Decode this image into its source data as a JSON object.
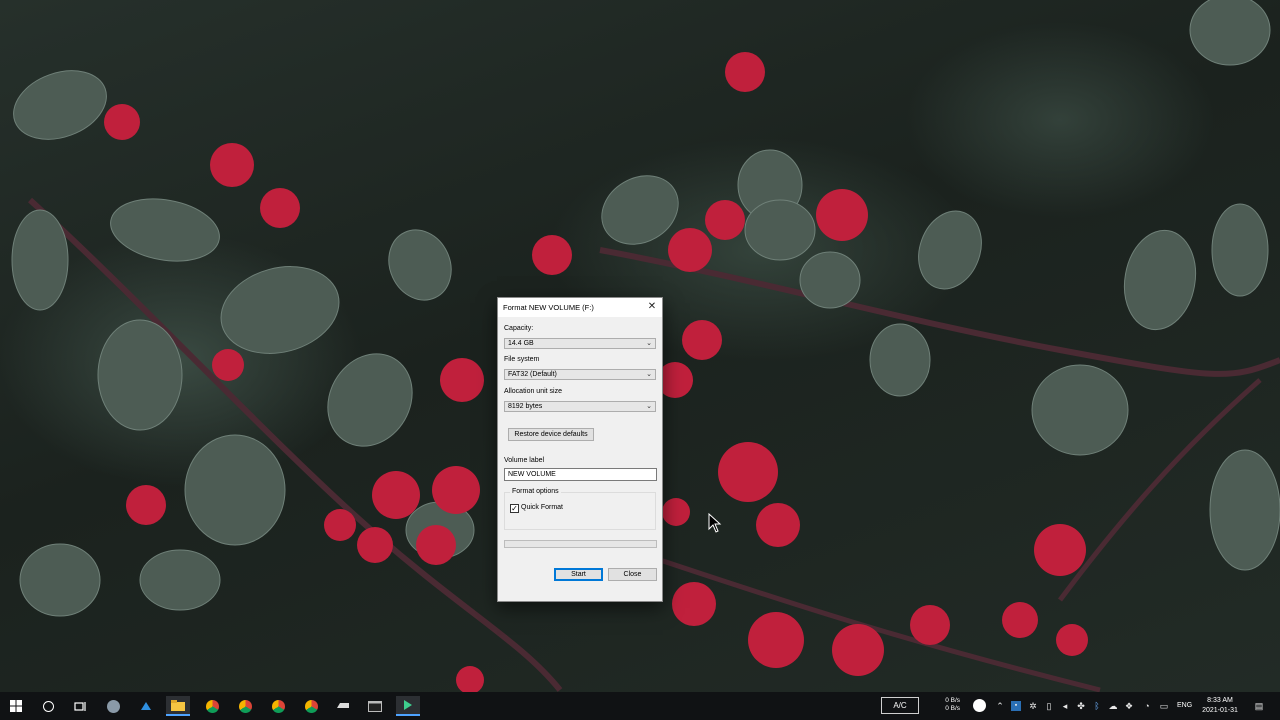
{
  "dialog": {
    "title": "Format NEW VOLUME (F:)",
    "capacity_label": "Capacity:",
    "capacity_value": "14.4 GB",
    "file_system_label": "File system",
    "file_system_value": "FAT32 (Default)",
    "allocation_label": "Allocation unit size",
    "allocation_value": "8192 bytes",
    "restore_button": "Restore device defaults",
    "volume_label_label": "Volume label",
    "volume_label_value": "NEW VOLUME",
    "format_options_label": "Format options",
    "quick_format_label": "Quick Format",
    "quick_format_checked": true,
    "progress": 0,
    "start_button": "Start",
    "close_button": "Close"
  },
  "taskbar": {
    "ac_label": "A/C",
    "net_up": "0 B/s",
    "net_down": "0 B/s",
    "language": "ENG",
    "time": "8:33 AM",
    "date": "2021-01-31",
    "accent_color": "#4ea3ff"
  }
}
